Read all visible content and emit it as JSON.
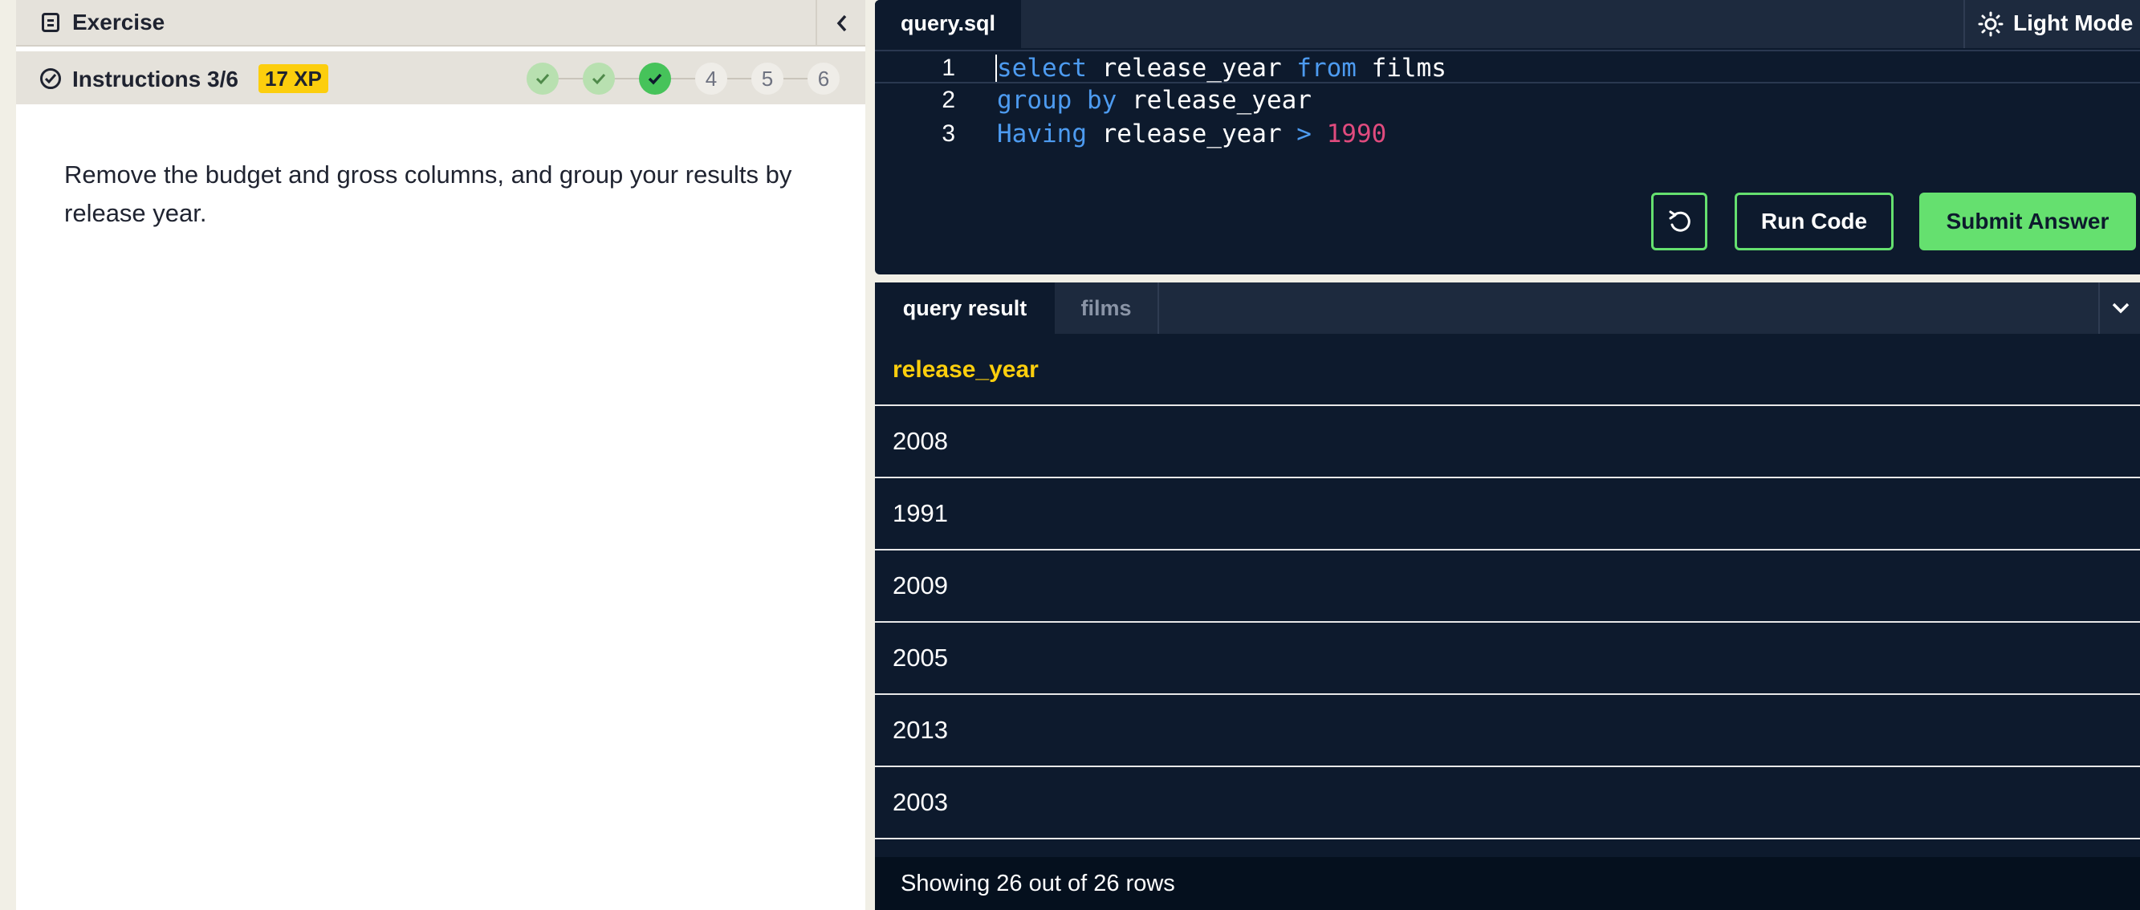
{
  "exercise": {
    "title": "Exercise",
    "instructions_title": "Instructions 3/6",
    "xp": "17 XP",
    "steps": [
      {
        "label": "",
        "state": "done"
      },
      {
        "label": "",
        "state": "done"
      },
      {
        "label": "",
        "state": "current"
      },
      {
        "label": "4",
        "state": "todo"
      },
      {
        "label": "5",
        "state": "todo"
      },
      {
        "label": "6",
        "state": "todo"
      }
    ],
    "instruction_text": "Remove the budget and gross columns, and group your results by release year."
  },
  "editor": {
    "file_tab": "query.sql",
    "light_mode_label": "Light Mode",
    "line_numbers": [
      "1",
      "2",
      "3"
    ],
    "run_label": "Run Code",
    "submit_label": "Submit Answer"
  },
  "results": {
    "tabs": [
      "query result",
      "films"
    ],
    "column": "release_year",
    "rows": [
      "2008",
      "1991",
      "2009",
      "2005",
      "2013",
      "2003"
    ],
    "footer": "Showing 26 out of 26 rows"
  },
  "colors": {
    "accent_green": "#65e06f",
    "xp_yellow": "#fcce0d",
    "editor_bg": "#0d1a2d",
    "keyword_blue": "#4d9bf0",
    "number_pink": "#e04b7e"
  }
}
